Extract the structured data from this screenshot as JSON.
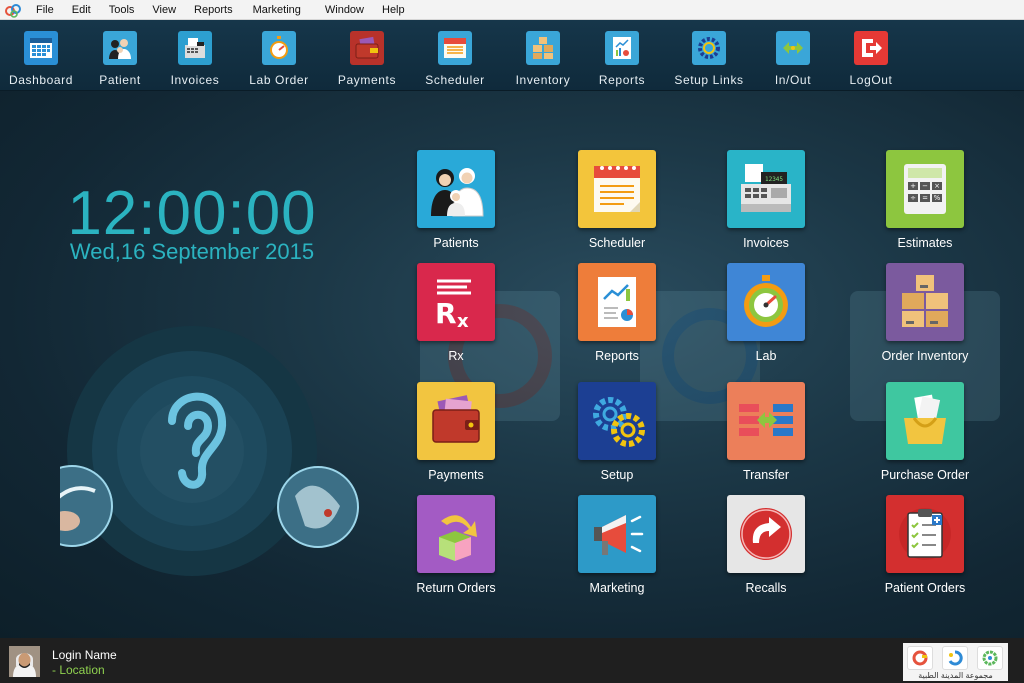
{
  "menu": {
    "items": [
      {
        "label": "File"
      },
      {
        "label": "Edit"
      },
      {
        "label": "Tools"
      },
      {
        "label": "View"
      },
      {
        "label": "Reports"
      },
      {
        "label": "Marketing"
      },
      {
        "label": "Window"
      },
      {
        "label": "Help"
      }
    ]
  },
  "toolbar": {
    "buttons": [
      {
        "label": "Dashboard",
        "icon": "dashboard-grid-icon",
        "color": "#2a8fd6"
      },
      {
        "label": "Patient",
        "icon": "patient-family-icon",
        "color": "#3aa6d8"
      },
      {
        "label": "Invoices",
        "icon": "cash-register-icon",
        "color": "#2d9fd0"
      },
      {
        "label": "Lab Order",
        "icon": "stopwatch-icon",
        "color": "#3aa6d8"
      },
      {
        "label": "Payments",
        "icon": "wallet-icon",
        "color": "#c0392b"
      },
      {
        "label": "Scheduler",
        "icon": "calendar-icon",
        "color": "#3aa6d8"
      },
      {
        "label": "Inventory",
        "icon": "boxes-icon",
        "color": "#3aa6d8"
      },
      {
        "label": "Reports",
        "icon": "report-chart-icon",
        "color": "#3aa6d8"
      },
      {
        "label": "Setup Links",
        "icon": "gears-icon",
        "color": "#3aa6d8"
      },
      {
        "label": "In/Out",
        "icon": "in-out-arrows-icon",
        "color": "#3aa6d8"
      },
      {
        "label": "LogOut",
        "icon": "logout-icon",
        "color": "#e53935"
      }
    ]
  },
  "clock": {
    "time": "12:00:00",
    "date": "Wed,16 September 2015"
  },
  "tiles": [
    {
      "label": "Patients",
      "icon": "patient-family-icon",
      "color": "#29a9d8"
    },
    {
      "label": "Scheduler",
      "icon": "calendar-icon",
      "color": "#f3c53b"
    },
    {
      "label": "Invoices",
      "icon": "cash-register-icon",
      "color": "#29b4c8"
    },
    {
      "label": "Estimates",
      "icon": "calculator-icon",
      "color": "#8dc63f"
    },
    {
      "label": "Rx",
      "icon": "rx-icon",
      "color": "#d9284c"
    },
    {
      "label": "Reports",
      "icon": "report-chart-icon",
      "color": "#ee7d3a"
    },
    {
      "label": "Lab",
      "icon": "stopwatch-icon",
      "color": "#3f86d6"
    },
    {
      "label": "Order Inventory",
      "icon": "boxes-icon",
      "color": "#7b5a9e"
    },
    {
      "label": "Payments",
      "icon": "wallet-icon",
      "color": "#f2c540"
    },
    {
      "label": "Setup",
      "icon": "gears-icon",
      "color": "#1c3f93"
    },
    {
      "label": "Transfer",
      "icon": "transfer-icon",
      "color": "#ec7f5a"
    },
    {
      "label": "Purchase Order",
      "icon": "shopping-basket-icon",
      "color": "#3fc7a0"
    },
    {
      "label": "Return Orders",
      "icon": "return-box-icon",
      "color": "#a35bc4"
    },
    {
      "label": "Marketing",
      "icon": "megaphone-icon",
      "color": "#2d9ac8"
    },
    {
      "label": "Recalls",
      "icon": "recall-arrow-icon",
      "color": "#e6e6e6"
    },
    {
      "label": "Patient Orders",
      "icon": "clipboard-icon",
      "color": "#d32f2f"
    }
  ],
  "status": {
    "login_name": "Login Name",
    "location": "- Location",
    "brand_text": "مجموعة المدينة الطبية"
  }
}
